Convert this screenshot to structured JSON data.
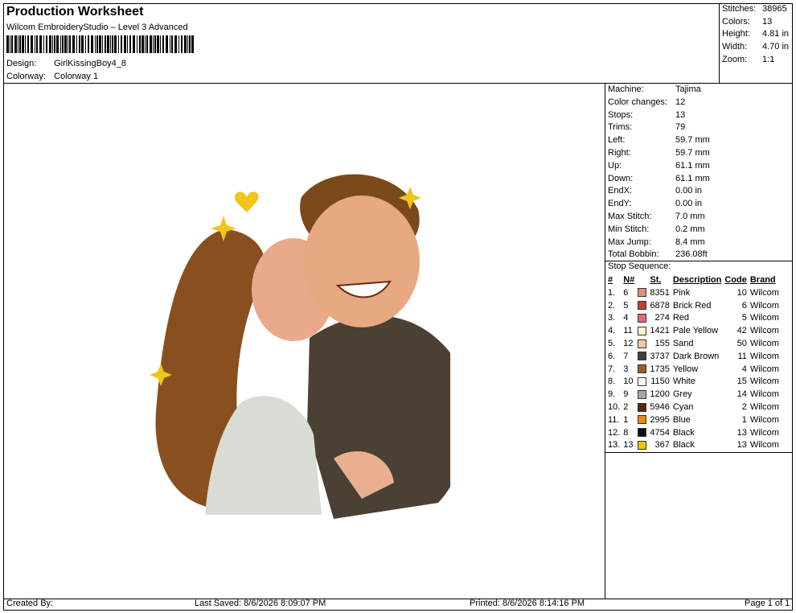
{
  "header": {
    "title": "Production Worksheet",
    "subtitle": "Wilcom EmbroideryStudio – Level 3 Advanced",
    "design_label": "Design:",
    "design_value": "GirlKissingBoy4_8",
    "colorway_label": "Colorway:",
    "colorway_value": "Colorway 1"
  },
  "stats": [
    {
      "label": "Stitches:",
      "value": "38965"
    },
    {
      "label": "Colors:",
      "value": "13"
    },
    {
      "label": "Height:",
      "value": "4.81 in"
    },
    {
      "label": "Width:",
      "value": "4.70 in"
    },
    {
      "label": "Zoom:",
      "value": "1:1"
    }
  ],
  "specs": [
    {
      "label": "Machine:",
      "value": "Tajima"
    },
    {
      "label": "Color changes:",
      "value": "12"
    },
    {
      "label": "Stops:",
      "value": "13"
    },
    {
      "label": "Trims:",
      "value": "79"
    },
    {
      "label": "Left:",
      "value": "59.7 mm"
    },
    {
      "label": "Right:",
      "value": "59.7 mm"
    },
    {
      "label": "Up:",
      "value": "61.1 mm"
    },
    {
      "label": "Down:",
      "value": "61.1 mm"
    },
    {
      "label": "EndX:",
      "value": "0.00 in"
    },
    {
      "label": "EndY:",
      "value": "0.00 in"
    },
    {
      "label": "Max Stitch:",
      "value": "7.0 mm"
    },
    {
      "label": "Min Stitch:",
      "value": "0.2 mm"
    },
    {
      "label": "Max Jump:",
      "value": "8.4 mm"
    },
    {
      "label": "Total Bobbin:",
      "value": "236.08ft"
    }
  ],
  "stop_sequence": {
    "title": "Stop Sequence:",
    "columns": [
      "#",
      "N#",
      "St.",
      "Description",
      "Code",
      "Brand"
    ],
    "rows": [
      {
        "idx": "1.",
        "n": "6",
        "color": "#e0907a",
        "st": "8351",
        "desc": "Pink",
        "code": "10",
        "brand": "Wilcom"
      },
      {
        "idx": "2.",
        "n": "5",
        "color": "#c0402c",
        "st": "6878",
        "desc": "Brick Red",
        "code": "6",
        "brand": "Wilcom"
      },
      {
        "idx": "3.",
        "n": "4",
        "color": "#e06a78",
        "st": "274",
        "desc": "Red",
        "code": "5",
        "brand": "Wilcom"
      },
      {
        "idx": "4.",
        "n": "11",
        "color": "#fdf6c8",
        "st": "1421",
        "desc": "Pale Yellow",
        "code": "42",
        "brand": "Wilcom"
      },
      {
        "idx": "5.",
        "n": "12",
        "color": "#f2c8a0",
        "st": "155",
        "desc": "Sand",
        "code": "50",
        "brand": "Wilcom"
      },
      {
        "idx": "6.",
        "n": "7",
        "color": "#404040",
        "st": "3737",
        "desc": "Dark Brown",
        "code": "11",
        "brand": "Wilcom"
      },
      {
        "idx": "7.",
        "n": "3",
        "color": "#96602e",
        "st": "1735",
        "desc": "Yellow",
        "code": "4",
        "brand": "Wilcom"
      },
      {
        "idx": "8.",
        "n": "10",
        "color": "#ffffff",
        "st": "1150",
        "desc": "White",
        "code": "15",
        "brand": "Wilcom"
      },
      {
        "idx": "9.",
        "n": "9",
        "color": "#a8a8a8",
        "st": "1200",
        "desc": "Grey",
        "code": "14",
        "brand": "Wilcom"
      },
      {
        "idx": "10.",
        "n": "2",
        "color": "#5a2408",
        "st": "5946",
        "desc": "Cyan",
        "code": "2",
        "brand": "Wilcom"
      },
      {
        "idx": "11.",
        "n": "1",
        "color": "#e88a18",
        "st": "2995",
        "desc": "Blue",
        "code": "1",
        "brand": "Wilcom"
      },
      {
        "idx": "12.",
        "n": "8",
        "color": "#101010",
        "st": "4754",
        "desc": "Black",
        "code": "13",
        "brand": "Wilcom"
      },
      {
        "idx": "13.",
        "n": "13",
        "color": "#f5c400",
        "st": "367",
        "desc": "Black",
        "code": "13",
        "brand": "Wilcom"
      }
    ]
  },
  "footer": {
    "created_by": "Created By:",
    "last_saved": "Last Saved: 8/6/2026 8:09:07 PM",
    "printed": "Printed: 8/6/2026 8:14:16 PM",
    "page": "Page 1 of 1"
  }
}
